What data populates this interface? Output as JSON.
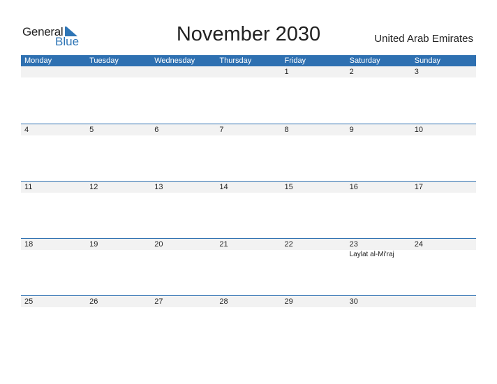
{
  "logo": {
    "general": "General",
    "blue": "Blue"
  },
  "title": "November 2030",
  "country": "United Arab Emirates",
  "weekdays": [
    "Monday",
    "Tuesday",
    "Wednesday",
    "Thursday",
    "Friday",
    "Saturday",
    "Sunday"
  ],
  "weeks": [
    {
      "days": [
        "",
        "",
        "",
        "",
        "1",
        "2",
        "3"
      ],
      "holidays": [
        "",
        "",
        "",
        "",
        "",
        "",
        ""
      ]
    },
    {
      "days": [
        "4",
        "5",
        "6",
        "7",
        "8",
        "9",
        "10"
      ],
      "holidays": [
        "",
        "",
        "",
        "",
        "",
        "",
        ""
      ]
    },
    {
      "days": [
        "11",
        "12",
        "13",
        "14",
        "15",
        "16",
        "17"
      ],
      "holidays": [
        "",
        "",
        "",
        "",
        "",
        "",
        ""
      ]
    },
    {
      "days": [
        "18",
        "19",
        "20",
        "21",
        "22",
        "23",
        "24"
      ],
      "holidays": [
        "",
        "",
        "",
        "",
        "",
        "Laylat al-Mi'raj",
        ""
      ]
    },
    {
      "days": [
        "25",
        "26",
        "27",
        "28",
        "29",
        "30",
        ""
      ],
      "holidays": [
        "",
        "",
        "",
        "",
        "",
        "",
        ""
      ]
    }
  ],
  "colors": {
    "accent": "#2e70b1",
    "row_bg": "#f2f2f2"
  }
}
